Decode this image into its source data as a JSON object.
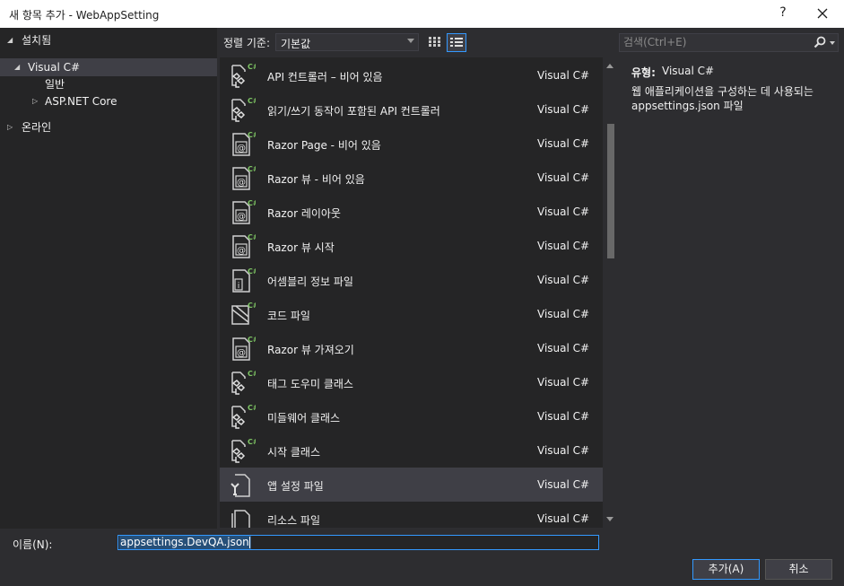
{
  "window": {
    "title": "새 항목 추가 - WebAppSetting",
    "help_label": "?"
  },
  "tree": {
    "installed": "설치됨",
    "visual_csharp": "Visual C#",
    "general": "일반",
    "aspnet_core": "ASP.NET Core",
    "online": "온라인"
  },
  "toolbar": {
    "sort_label": "정렬 기준:",
    "sort_value": "기본값"
  },
  "search": {
    "placeholder": "검색(Ctrl+E)"
  },
  "templates": [
    {
      "name": "API 컨트롤러 – 비어 있음",
      "type": "Visual C#",
      "icon": "class-csharp-icon"
    },
    {
      "name": "읽기/쓰기 동작이 포함된 API 컨트롤러",
      "type": "Visual C#",
      "icon": "class-csharp-icon"
    },
    {
      "name": "Razor Page - 비어 있음",
      "type": "Visual C#",
      "icon": "razor-file-icon"
    },
    {
      "name": "Razor 뷰 - 비어 있음",
      "type": "Visual C#",
      "icon": "razor-file-icon"
    },
    {
      "name": "Razor 레이아웃",
      "type": "Visual C#",
      "icon": "razor-file-icon"
    },
    {
      "name": "Razor 뷰 시작",
      "type": "Visual C#",
      "icon": "razor-file-icon"
    },
    {
      "name": "어셈블리 정보 파일",
      "type": "Visual C#",
      "icon": "info-file-icon"
    },
    {
      "name": "코드 파일",
      "type": "Visual C#",
      "icon": "code-file-icon"
    },
    {
      "name": "Razor 뷰 가져오기",
      "type": "Visual C#",
      "icon": "razor-file-icon"
    },
    {
      "name": "태그 도우미 클래스",
      "type": "Visual C#",
      "icon": "class-csharp-icon"
    },
    {
      "name": "미들웨어 클래스",
      "type": "Visual C#",
      "icon": "class-csharp-icon"
    },
    {
      "name": "시작 클래스",
      "type": "Visual C#",
      "icon": "class-csharp-icon"
    },
    {
      "name": "앱 설정 파일",
      "type": "Visual C#",
      "icon": "settings-file-icon",
      "selected": true
    },
    {
      "name": "리소스 파일",
      "type": "Visual C#",
      "icon": "resource-file-icon"
    }
  ],
  "detail": {
    "type_label": "유형:",
    "type_value": "Visual C#",
    "description": "웹 애플리케이션을 구성하는 데 사용되는 appsettings.json 파일"
  },
  "name_field": {
    "label": "이름(N):",
    "value": "appsettings.DevQA.json"
  },
  "buttons": {
    "add": "추가(A)",
    "cancel": "취소"
  },
  "colors": {
    "background": "#2d2d30",
    "pane": "#252526",
    "accent": "#3399ff",
    "selection": "#3f3f46",
    "csharp_green": "#7ec664"
  }
}
